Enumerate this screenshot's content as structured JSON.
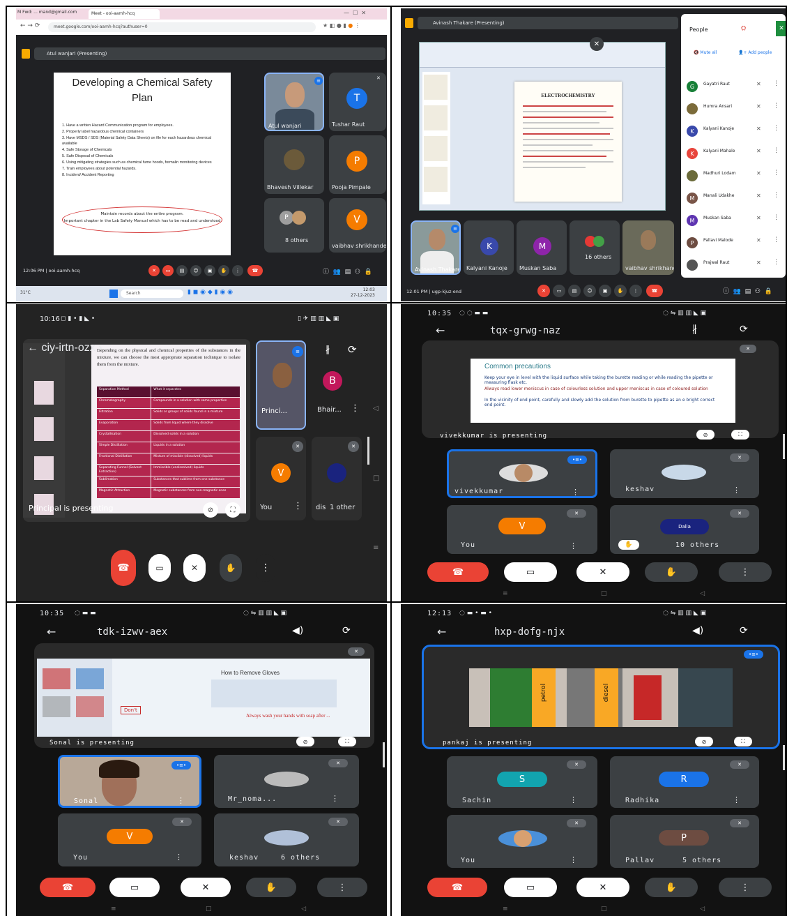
{
  "panel1": {
    "browser_tab_1": "M Fwd: ... mand@gmail.com",
    "browser_tab_2": "Meet - ooi-aamh-hcq",
    "url": "meet.google.com/ooi-aamh-hcq?authuser=0",
    "presenter_bar": "Atul wanjari (Presenting)",
    "slide_title_1": "Developing a Chemical Safety",
    "slide_title_2": "Plan",
    "slide_items": [
      "1.  Have a written Hazard Communication program for employees.",
      "2.  Properly label hazardous chemical containers",
      "3.  Have MSDS / SDS (Material Safety Data Sheets) on file for each hazardous chemical available",
      "4.  Safe Storage of Chemicals",
      "5.  Safe Disposal of Chemicals",
      "6.  Using mitigating strategies such as chemical fume hoods, formalin monitoring devices",
      "7.  Train employees about potential hazards.",
      "8.  Incident/ Accident Reporting"
    ],
    "slide_oval_1": "Maintain records about the entire program.",
    "slide_oval_2": "Important chapter in the Lab Safety Manual which has to be read and understood",
    "participants": [
      {
        "name": "Atul wanjari",
        "initial": ""
      },
      {
        "name": "Tushar Raut",
        "initial": "T",
        "color": "#1a73e8"
      },
      {
        "name": "Bhavesh Villekar",
        "initial": ""
      },
      {
        "name": "Pooja Pimpale",
        "initial": "P",
        "color": "#f57c00"
      },
      {
        "name": "8 others",
        "initial": ""
      },
      {
        "name": "vaibhav shrikhande",
        "initial": "V",
        "color": "#f57c00"
      }
    ],
    "time_code": "12:06 PM  |  ooi-aamh-hcq",
    "taskbar_weather": "31°C",
    "taskbar_search": "Search",
    "taskbar_time": "12:03",
    "taskbar_date": "27-12-2023"
  },
  "panel2": {
    "presenter_bar": "Avinash Thakare (Presenting)",
    "doc_title": "ELECTROCHEMISTRY",
    "people_title": "People",
    "mute_all": "Mute all",
    "add_people": "Add people",
    "people_list": [
      {
        "name": "Gayatri Raut",
        "color": "#188038",
        "initial": "G"
      },
      {
        "name": "Humra Ansari",
        "color": "#7b6b3a",
        "initial": ""
      },
      {
        "name": "Kalyani Kanoje",
        "color": "#3949ab",
        "initial": "K"
      },
      {
        "name": "Kalyani Mahale",
        "color": "#e8453c",
        "initial": "K"
      },
      {
        "name": "Madhuri Lodam",
        "color": "#6b6b3a",
        "initial": ""
      },
      {
        "name": "Manali Udakhe",
        "color": "#795548",
        "initial": "M"
      },
      {
        "name": "Muskan Saba",
        "color": "#5e35b1",
        "initial": "M"
      },
      {
        "name": "Pallavi Malode",
        "color": "#6d4c41",
        "initial": "P"
      },
      {
        "name": "Prajwal Raut",
        "color": "#555",
        "initial": ""
      }
    ],
    "tiles": [
      {
        "name": "Avinash Thakare",
        "initial": ""
      },
      {
        "name": "Kalyani Kanoje",
        "initial": "K",
        "color": "#3949ab"
      },
      {
        "name": "Muskan Saba",
        "initial": "M",
        "color": "#8e24aa"
      },
      {
        "name": "16 others",
        "initial": ""
      },
      {
        "name": "vaibhav shrikhande",
        "initial": ""
      }
    ],
    "time_code": "12:01 PM  |  ugp-kjuz-end"
  },
  "panel3": {
    "status_time": "10:16",
    "meeting_code": "ciy-irtn-ozx",
    "caption": "Principal is presenting",
    "slide_text": "Depending on the physical and chemical properties of the substances in the mixture, we can choose the most appropriate separation technique to isolate them from the mixture.",
    "table_head": [
      "Separation Method",
      "What it separates"
    ],
    "table_rows": [
      [
        "Chromatography",
        "Compounds in a solution with same properties"
      ],
      [
        "Filtration",
        "Solids or groups of solids found in a mixture"
      ],
      [
        "Evaporation",
        "Solids from liquid where they dissolve"
      ],
      [
        "Crystallisation",
        "Dissolved solids in a solution"
      ],
      [
        "Simple Distillation",
        "Liquids in a solution"
      ],
      [
        "Fractional Distillation",
        "Mixture of miscible (dissolved) liquids"
      ],
      [
        "Separating Funnel (Solvent Extraction)",
        "Immiscible (undissolved) liquids"
      ],
      [
        "Sublimation",
        "Substances that sublime from one substance"
      ],
      [
        "Magnetic Attraction",
        "Magnetic substances from non-magnetic ones"
      ]
    ],
    "tiles": [
      {
        "name": "Princi...",
        "initial": ""
      },
      {
        "name": "Bhair...",
        "initial": "B",
        "color": "#c2185b"
      },
      {
        "name": "You",
        "initial": "V",
        "color": "#f57c00"
      },
      {
        "name": "dis",
        "initial": ""
      }
    ],
    "others": "1 other"
  },
  "panel4": {
    "status_time": "10:35",
    "meeting_code": "tqx-grwg-naz",
    "slide_title": "Common precautions",
    "slide_lines": [
      "Keep your eye in level with the liquid surface while taking the burette reading or while reading the pipette or measuring flask etc.",
      "Always read lower meniscus in case of colourless solution and upper meniscus in case of coloured solution",
      "In the vicinity of end point, carefully and slowly add the solution from burette to pipette as an e bright correct end point."
    ],
    "caption": "vivekkumar is presenting",
    "tiles": [
      {
        "name": "vivekkumar",
        "initial": ""
      },
      {
        "name": "keshav",
        "initial": ""
      },
      {
        "name": "You",
        "initial": "V",
        "color": "#f57c00"
      },
      {
        "name": "10 others",
        "initial": ""
      }
    ]
  },
  "panel5": {
    "status_time": "10:35",
    "meeting_code": "tdk-izwv-aex",
    "caption": "Sonal is presenting",
    "slide_heading": "How to Remove Gloves",
    "slide_dont": "Don't",
    "slide_always": "Always wash your hands with soap after ...",
    "tiles": [
      {
        "name": "Sonal",
        "initial": ""
      },
      {
        "name": "Mr_noma...",
        "initial": ""
      },
      {
        "name": "You",
        "initial": "V",
        "color": "#f57c00"
      },
      {
        "name": "keshav",
        "initial": ""
      }
    ],
    "others": "6 others"
  },
  "panel6": {
    "status_time": "12:13",
    "meeting_code": "hxp-dofg-njx",
    "caption": "pankaj is presenting",
    "pump_labels": [
      "petrol",
      "diesel"
    ],
    "tiles": [
      {
        "name": "Sachin",
        "initial": "S",
        "color": "#12a4af"
      },
      {
        "name": "Radhika",
        "initial": "R",
        "color": "#1a73e8"
      },
      {
        "name": "You",
        "initial": ""
      },
      {
        "name": "Pallav",
        "initial": "P",
        "color": "#6d4c41"
      }
    ],
    "others": "5 others"
  }
}
